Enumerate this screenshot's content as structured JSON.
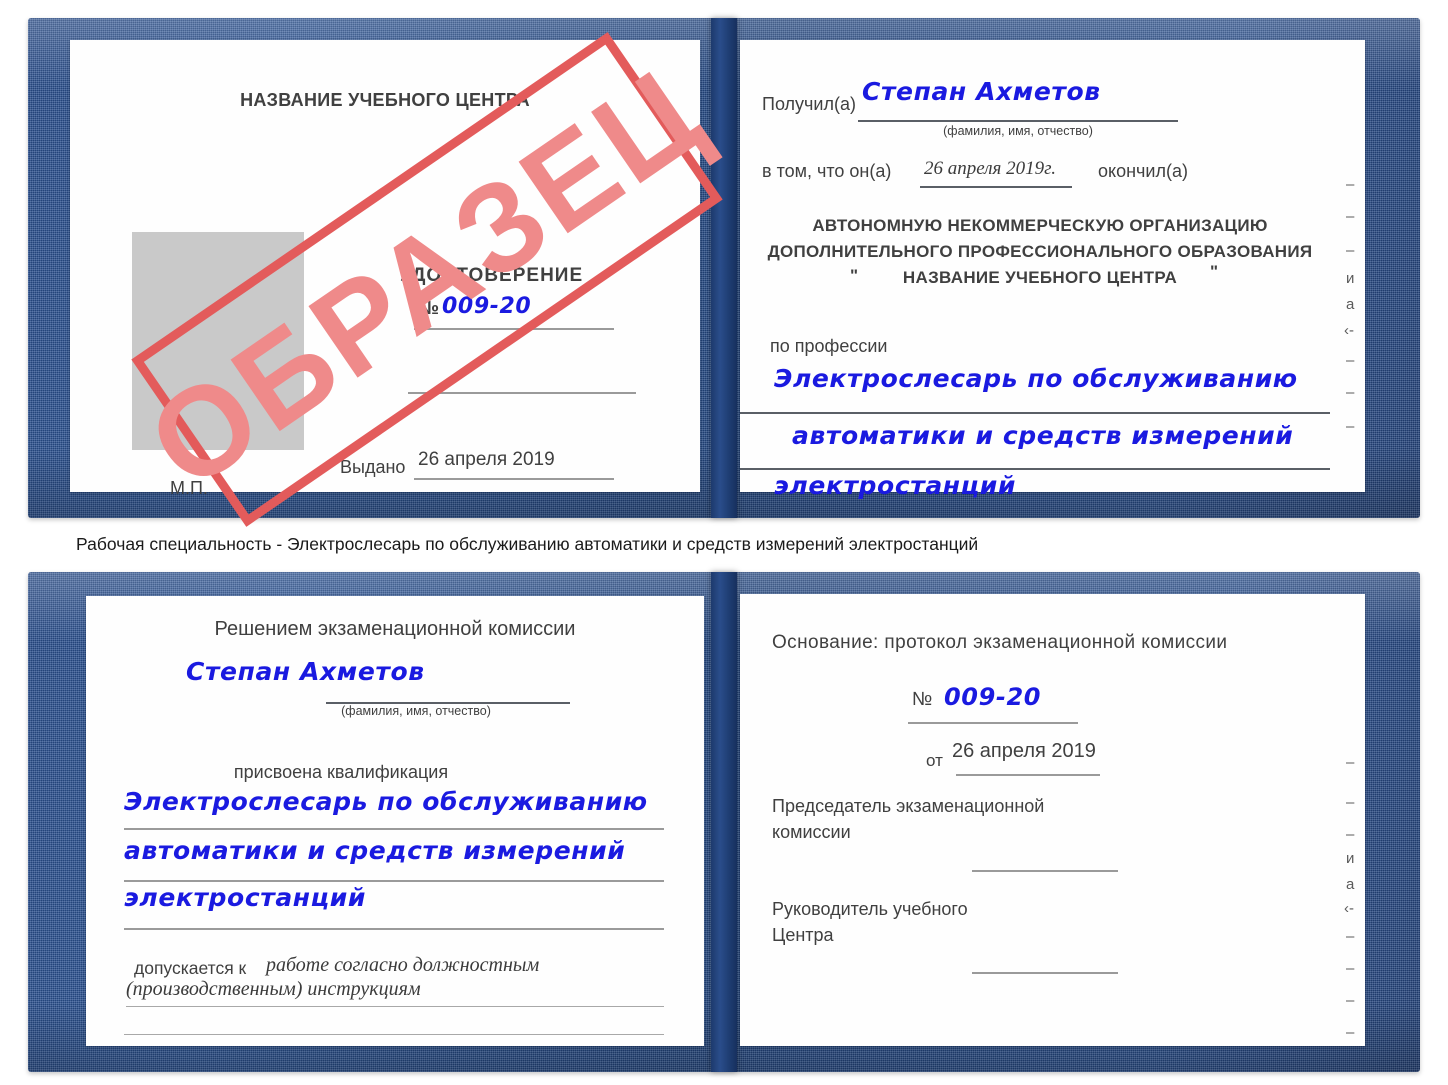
{
  "caption": "Рабочая специальность - Электрослесарь по обслуживанию автоматики и средств измерений электростанций",
  "stamp": {
    "label": "ОБРАЗЕЦ",
    "border_color": "#e35b5b",
    "text_color": "#ef8a8a"
  },
  "colors": {
    "cover_blue": "#2a4f8e",
    "paper_white": "#fefefe",
    "handwriting_blue": "#1a1ae0",
    "printed_gray": "#404040",
    "rule_gray": "#9a9a9a",
    "photo_placeholder_gray": "#c9c9c9"
  },
  "certificate_top": {
    "left_page": {
      "org_title": "НАЗВАНИЕ УЧЕБНОГО ЦЕНТРА",
      "doc_title": "УДОСТОВЕРЕНИЕ",
      "number_label": "№",
      "number_value": "009-20",
      "issued_label": "Выдано",
      "issued_value": "26 апреля 2019",
      "seal_label": "М.П.",
      "photo_placeholder": "photo-area"
    },
    "right_page": {
      "received_label": "Получил(а)",
      "received_value": "Степан Ахметов",
      "fio_hint": "(фамилия, имя, отчество)",
      "in_that_label": "в том, что он(а)",
      "in_that_value": "26 апреля 2019г.",
      "finished_label": "окончил(а)",
      "org_line1": "АВТОНОМНУЮ НЕКОММЕРЧЕСКУЮ ОРГАНИЗАЦИЮ",
      "org_line2": "ДОПОЛНИТЕЛЬНОГО ПРОФЕССИОНАЛЬНОГО ОБРАЗОВАНИЯ",
      "org_quote_open": "\"",
      "org_line3": "НАЗВАНИЕ УЧЕБНОГО ЦЕНТРА",
      "org_quote_close": "\"",
      "profession_label": "по профессии",
      "profession_line1": "Электрослесарь по обслуживанию",
      "profession_line2": "автоматики и средств измерений",
      "profession_line3": "электростанций",
      "edge_fragments": [
        "–",
        "–",
        "–",
        "–",
        "и",
        "а",
        "‹-",
        "–",
        "–",
        "–"
      ]
    }
  },
  "certificate_bottom": {
    "left_page": {
      "decision_title": "Решением экзаменационной комиссии",
      "name_value": "Степан Ахметов",
      "fio_hint": "(фамилия, имя, отчество)",
      "qualification_label": "присвоена квалификация",
      "qualification_line1": "Электрослесарь по обслуживанию",
      "qualification_line2": "автоматики и средств измерений",
      "qualification_line3": "электростанций",
      "admitted_label": "допускается к",
      "admitted_line1": "работе согласно должностным",
      "admitted_line2": "(производственным) инструкциям"
    },
    "right_page": {
      "basis_label": "Основание: протокол экзаменационной комиссии",
      "number_label": "№",
      "number_value": "009-20",
      "date_label": "от",
      "date_value": "26 апреля 2019",
      "chairman_line1": "Председатель экзаменационной",
      "chairman_line2": "комиссии",
      "head_line1": "Руководитель учебного",
      "head_line2": "Центра",
      "edge_fragments": [
        "–",
        "–",
        "–",
        "и",
        "а",
        "‹-",
        "–",
        "–",
        "–",
        "–"
      ]
    }
  }
}
